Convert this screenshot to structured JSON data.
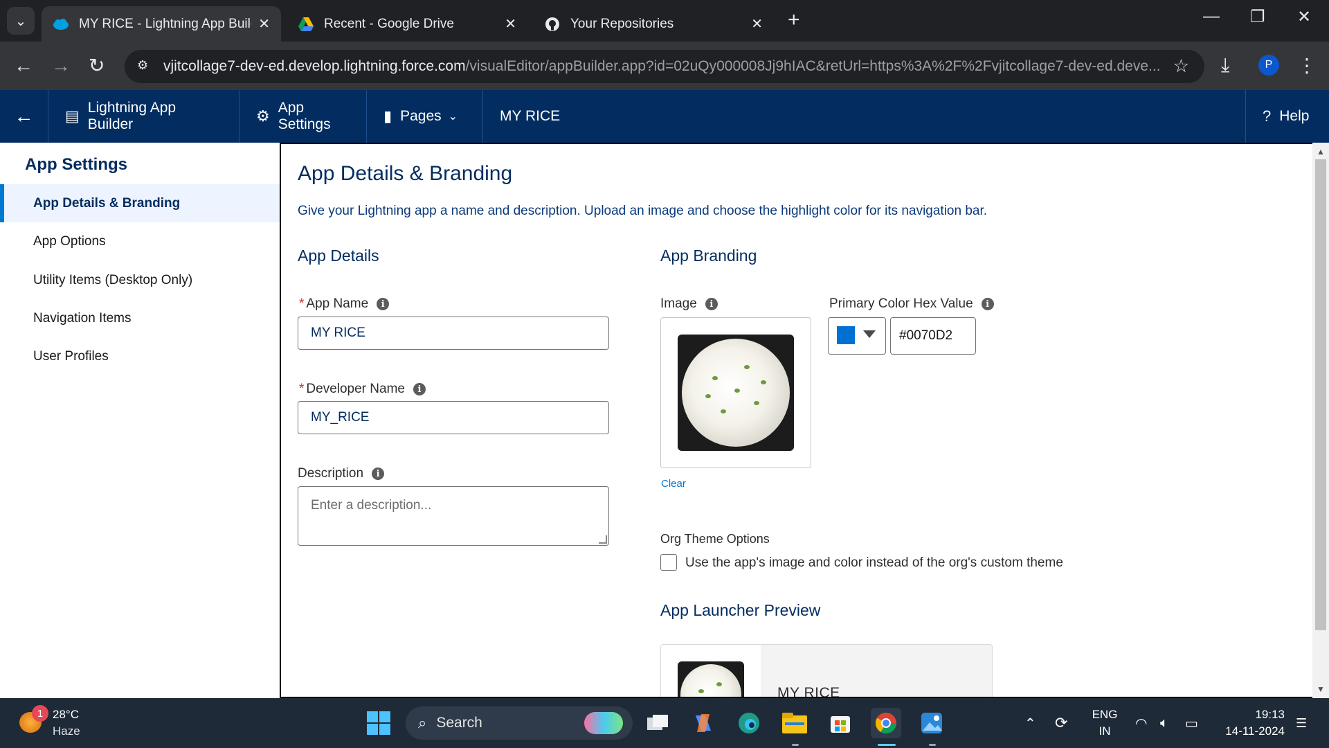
{
  "browser": {
    "tabs": [
      {
        "title": "MY RICE - Lightning App Builde",
        "active": true,
        "icon": "salesforce-cloud-icon"
      },
      {
        "title": "Recent - Google Drive",
        "active": false,
        "icon": "google-drive-icon"
      },
      {
        "title": "Your Repositories",
        "active": false,
        "icon": "github-icon"
      }
    ],
    "url_host": "vjitcollage7-dev-ed.develop.lightning.force.com",
    "url_path": "/visualEditor/appBuilder.app?id=02uQy000008Jj9hIAC&retUrl=https%3A%2F%2Fvjitcollage7-dev-ed.deve...",
    "profile_initial": "P"
  },
  "sf_header": {
    "title": "Lightning App Builder",
    "app_settings": "App Settings",
    "pages": "Pages",
    "app_name": "MY RICE",
    "help": "Help"
  },
  "sidebar": {
    "heading": "App Settings",
    "items": [
      {
        "label": "App Details & Branding",
        "active": true
      },
      {
        "label": "App Options",
        "active": false
      },
      {
        "label": "Utility Items (Desktop Only)",
        "active": false
      },
      {
        "label": "Navigation Items",
        "active": false
      },
      {
        "label": "User Profiles",
        "active": false
      }
    ]
  },
  "main": {
    "title": "App Details & Branding",
    "description": "Give your Lightning app a name and description. Upload an image and choose the highlight color for its navigation bar.",
    "details": {
      "heading": "App Details",
      "app_name_label": "App Name",
      "app_name_value": "MY RICE",
      "dev_name_label": "Developer Name",
      "dev_name_value": "MY_RICE",
      "description_label": "Description",
      "description_placeholder": "Enter a description..."
    },
    "branding": {
      "heading": "App Branding",
      "image_label": "Image",
      "clear_link": "Clear",
      "color_label": "Primary Color Hex Value",
      "color_value": "#0070D2",
      "org_theme_label": "Org Theme Options",
      "org_theme_checkbox": "Use the app's image and color instead of the org's custom theme",
      "org_theme_checked": false
    },
    "preview": {
      "heading": "App Launcher Preview",
      "app_name": "MY RICE"
    }
  },
  "taskbar": {
    "weather_temp": "28°C",
    "weather_cond": "Haze",
    "weather_badge": "1",
    "search_label": "Search",
    "lang_top": "ENG",
    "lang_bottom": "IN",
    "time": "19:13",
    "date": "14-11-2024"
  },
  "colors": {
    "sf_header": "#032d60",
    "brand_primary": "#0070D2",
    "browser_dark": "#202124"
  }
}
